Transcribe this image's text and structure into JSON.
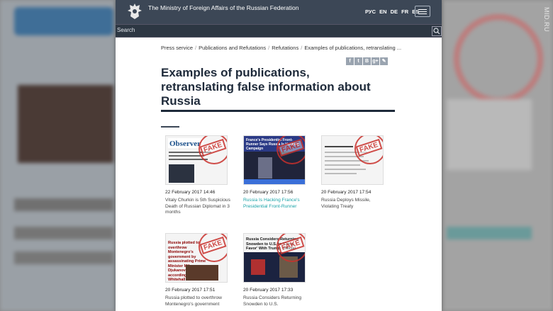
{
  "watermark": "MID.RU",
  "header": {
    "site_title": "The Ministry of Foreign Affairs of the Russian Federation",
    "languages": [
      "РУС",
      "EN",
      "DE",
      "FR",
      "ES"
    ],
    "search_placeholder": "Search"
  },
  "breadcrumb": [
    "Press service",
    "Publications and Refutations",
    "Refutations",
    "Examples of publications, retranslating ..."
  ],
  "share_icons": [
    "f",
    "t",
    "B",
    "g+",
    "✎"
  ],
  "page_title": "Examples of publications, retranslating false information about Russia",
  "thumbnails": {
    "t1_logo": "Observer",
    "t2_banner": "France's Presidential Front-Runner Says Russia Is Hacking Campaign",
    "t4_headline": "Russia plotted to overthrow Montenegro's government by assassinating Prime Minister Milo Djukanovic last year, according to senior Whitehall sources",
    "t5_headline": "Russia Considers Returning Snowden to U.S. to 'Curry Favor' With Trump: Official"
  },
  "stamp_text": "FAKE",
  "articles": [
    {
      "date": "22 February 2017 14:46",
      "headline": "Vitaly Churkin is 5th Suspicious Death of Russian Diplomat in 3 months",
      "link": false
    },
    {
      "date": "20 February 2017 17:56",
      "headline": "Russia Is Hacking France's Presidential Front-Runner",
      "link": true
    },
    {
      "date": "20 February 2017 17:54",
      "headline": "Russia Deploys Missile, Violating Treaty",
      "link": false
    },
    {
      "date": "20 February 2017 17:51",
      "headline": "Russia plotted to overthrow Montenegro's government",
      "link": false
    },
    {
      "date": "20 February 2017 17:33",
      "headline": "Russia Considers Returning Snowden to U.S.",
      "link": false
    }
  ]
}
